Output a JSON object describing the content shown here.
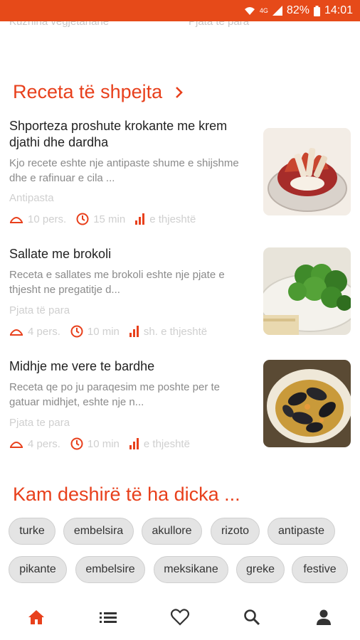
{
  "status_bar": {
    "network": "4G",
    "battery": "82%",
    "time": "14:01"
  },
  "top_categories": [
    "Kuzhina vegjetariane",
    "Pjata te para"
  ],
  "quick_recipes": {
    "title": "Receta të shpejta",
    "items": [
      {
        "title": "Shporteza proshute krokante me krem djathi dhe dardha",
        "description": "Kjo recete eshte nje antipaste shume e shijshme dhe e rafinuar e cila ...",
        "category": "Antipasta",
        "servings": "10 pers.",
        "time": "15 min",
        "difficulty": "e thjeshtë",
        "image": "prosciutto-baskets-photo"
      },
      {
        "title": "Sallate me brokoli",
        "description": "Receta e sallates me brokoli eshte nje pjate e thjesht ne pregatitje d...",
        "category": "Pjata të para",
        "servings": "4 pers.",
        "time": "10 min",
        "difficulty": "sh. e thjeshtë",
        "image": "broccoli-salad-photo"
      },
      {
        "title": "Midhje me vere te bardhe",
        "description": "Receta qe po ju paraqesim me poshte per te gatuar midhjet, eshte nje n...",
        "category": "Pjata te para",
        "servings": "4 pers.",
        "time": "10 min",
        "difficulty": "e thjeshtë",
        "image": "mussels-photo"
      }
    ]
  },
  "cravings": {
    "title": "Kam deshirë të ha dicka ...",
    "tags_row1": [
      "turke",
      "embelsira",
      "akullore",
      "rizoto",
      "antipaste"
    ],
    "tags_row2": [
      "pikante",
      "embelsire",
      "meksikane",
      "greke",
      "festive"
    ]
  },
  "bottom_nav": [
    "home-icon",
    "list-icon",
    "heart-icon",
    "search-icon",
    "person-icon"
  ],
  "colors": {
    "accent": "#e8401c",
    "statusbar": "#e64a19"
  }
}
